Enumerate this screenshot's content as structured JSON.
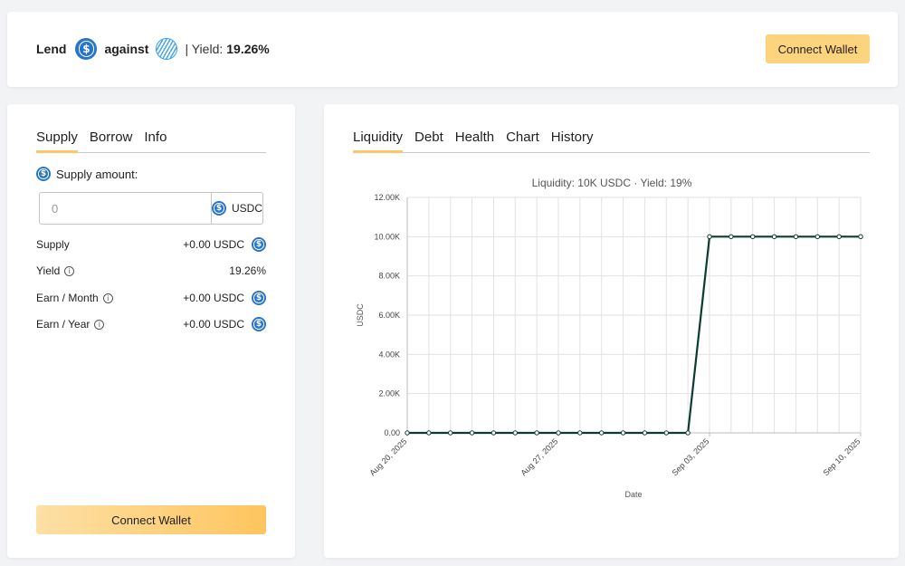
{
  "header": {
    "lend_label": "Lend",
    "against_label": "against",
    "yield_prefix": "| Yield:",
    "yield_value": "19.26%",
    "lend_token_icon": "usdc-coin-icon",
    "collateral_token_icon": "striped-token-icon",
    "connect_wallet_label": "Connect Wallet"
  },
  "left_panel": {
    "tabs": [
      "Supply",
      "Borrow",
      "Info"
    ],
    "active_tab": "Supply",
    "supply_amount_label": "Supply amount:",
    "amount_input": {
      "value": "",
      "placeholder": "0"
    },
    "amount_unit": "USDC",
    "rows": [
      {
        "label": "Supply",
        "value": "+0.00 USDC",
        "info": false,
        "coin": true
      },
      {
        "label": "Yield",
        "value": "19.26%",
        "info": true,
        "coin": false
      },
      {
        "label": "Earn / Month",
        "value": "+0.00 USDC",
        "info": true,
        "coin": true
      },
      {
        "label": "Earn / Year",
        "value": "+0.00 USDC",
        "info": true,
        "coin": true
      }
    ],
    "connect_wallet_label": "Connect Wallet",
    "coin_glyph": "$"
  },
  "right_panel": {
    "tabs": [
      "Liquidity",
      "Debt",
      "Health",
      "Chart",
      "History"
    ],
    "active_tab": "Liquidity"
  },
  "colors": {
    "accent": "#fdd37d",
    "usdc_blue": "#2775ca",
    "line": "#0d3b32"
  },
  "chart_data": {
    "type": "line",
    "title": "Liquidity: 10K USDC · Yield: 19%",
    "xlabel": "Date",
    "ylabel": "USDC",
    "ylim": [
      0,
      12000
    ],
    "y_ticks": [
      "0.00",
      "2.00K",
      "4.00K",
      "6.00K",
      "8.00K",
      "10.00K",
      "12.00K"
    ],
    "x_tick_labels": [
      "Aug 20, 2025",
      "Aug 27, 2025",
      "Sep 03, 2025",
      "Sep 10, 2025"
    ],
    "grid": true,
    "x": [
      "2025-08-20",
      "2025-08-21",
      "2025-08-22",
      "2025-08-23",
      "2025-08-24",
      "2025-08-25",
      "2025-08-26",
      "2025-08-27",
      "2025-08-28",
      "2025-08-29",
      "2025-08-30",
      "2025-08-31",
      "2025-09-01",
      "2025-09-02",
      "2025-09-03",
      "2025-09-04",
      "2025-09-05",
      "2025-09-06",
      "2025-09-07",
      "2025-09-08",
      "2025-09-09",
      "2025-09-10"
    ],
    "series": [
      {
        "values": [
          0,
          0,
          0,
          0,
          0,
          0,
          0,
          0,
          0,
          0,
          0,
          0,
          0,
          0,
          10000,
          10000,
          10000,
          10000,
          10000,
          10000,
          10000,
          10000
        ]
      }
    ]
  }
}
